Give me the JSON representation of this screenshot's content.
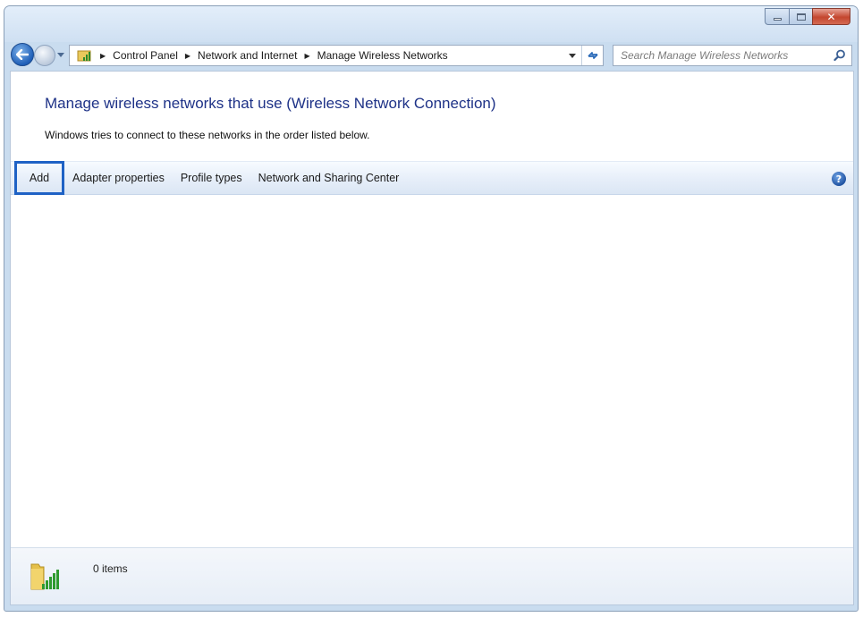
{
  "window": {
    "controls": {
      "minimize_icon": "minimize-icon",
      "maximize_icon": "maximize-icon",
      "close_icon": "close-icon"
    }
  },
  "navigation": {
    "breadcrumbs": [
      "Control Panel",
      "Network and Internet",
      "Manage Wireless Networks"
    ],
    "search_placeholder": "Search Manage Wireless Networks"
  },
  "page": {
    "title": "Manage wireless networks that use (Wireless Network Connection)",
    "description": "Windows tries to connect to these networks in the order listed below."
  },
  "toolbar": {
    "add_label": "Add",
    "adapter_properties_label": "Adapter properties",
    "profile_types_label": "Profile types",
    "network_sharing_label": "Network and Sharing Center",
    "help_glyph": "?"
  },
  "status": {
    "items_text": "0 items"
  },
  "colors": {
    "title_blue": "#1e3287",
    "highlight_border": "#1f62c5",
    "window_chrome": "#c9dcef"
  }
}
